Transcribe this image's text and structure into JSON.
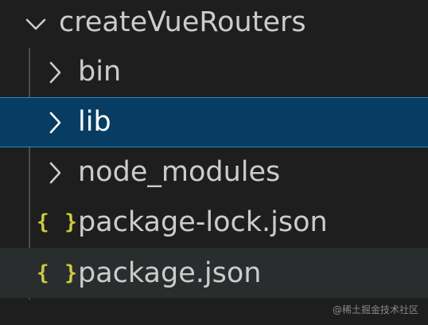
{
  "explorer": {
    "root": {
      "label": "createVueRouters",
      "icon": "chevron-down-icon"
    },
    "items": [
      {
        "label": "bin",
        "type": "folder",
        "icon": "chevron-right-icon",
        "state": "collapsed"
      },
      {
        "label": "lib",
        "type": "folder",
        "icon": "chevron-right-icon",
        "state": "selected"
      },
      {
        "label": "node_modules",
        "type": "folder",
        "icon": "chevron-right-icon",
        "state": "collapsed"
      },
      {
        "label": "package-lock.json",
        "type": "file",
        "icon": "json-braces-icon",
        "icon_text": "{ }"
      },
      {
        "label": "package.json",
        "type": "file",
        "icon": "json-braces-icon",
        "icon_text": "{ }",
        "state": "hovered"
      }
    ]
  },
  "watermark": "@稀土掘金技术社区",
  "colors": {
    "background": "#1e1e1e",
    "selected_background": "#073d62",
    "selected_border": "#2587c8",
    "hover_background": "#2a2d2e",
    "text": "#cccccc",
    "json_icon": "#cbcb41"
  }
}
